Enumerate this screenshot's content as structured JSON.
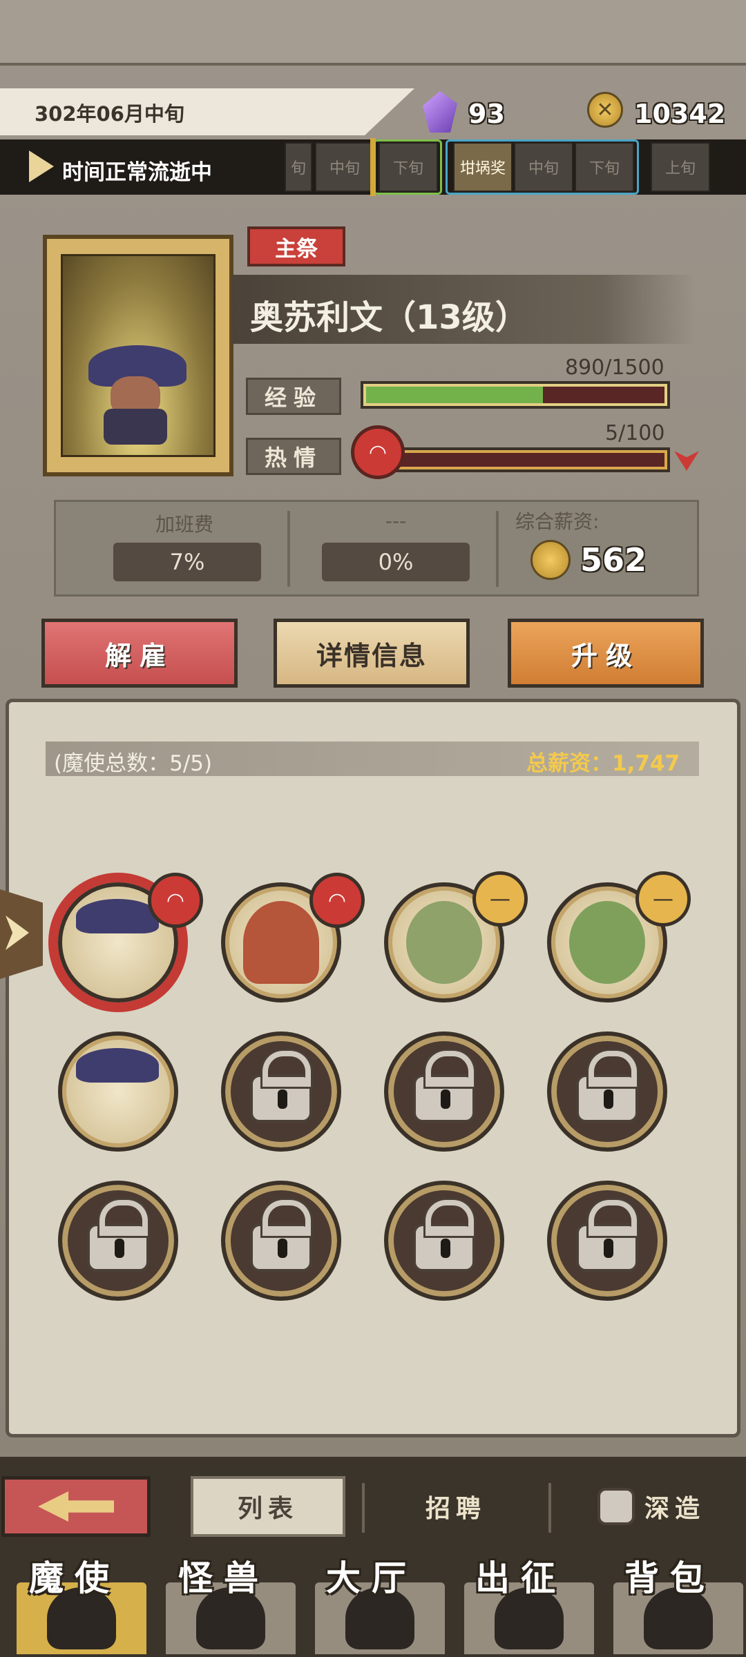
{
  "header": {
    "date": "302年06月中旬",
    "crystals": "93",
    "coins": "10342",
    "time_status": "时间正常流逝中",
    "timeline": [
      {
        "label": "旬"
      },
      {
        "label": "中旬"
      },
      {
        "label": "下旬"
      },
      {
        "label": "坩埚奖"
      },
      {
        "label": "中旬"
      },
      {
        "label": "下旬"
      },
      {
        "label": "上旬"
      }
    ]
  },
  "character": {
    "role": "主祭",
    "name": "奥苏利文（13级）",
    "exp_label": "经验",
    "exp_value": "890/1500",
    "exp_progress": 0.593,
    "passion_label": "热情",
    "passion_value": "5/100",
    "passion_progress": 0.05
  },
  "salary": {
    "overtime_title": "加班费",
    "overtime_value": "7%",
    "unknown_title": "---",
    "unknown_value": "0%",
    "total_title": "综合薪资:",
    "total_value": "562"
  },
  "actions": {
    "fire": "解雇",
    "details": "详情信息",
    "upgrade": "升级"
  },
  "roster": {
    "count": "(魔使总数：5/5)",
    "total_pay": "总薪资：1,747"
  },
  "subtabs": {
    "list": "列表",
    "recruit": "招聘",
    "deep": "深造"
  },
  "nav": [
    "魔使",
    "怪兽",
    "大厅",
    "出征",
    "背包"
  ],
  "colors": {
    "accent_red": "#c9413a",
    "exp_green": "#73b24a",
    "gold": "#f4c94d"
  }
}
